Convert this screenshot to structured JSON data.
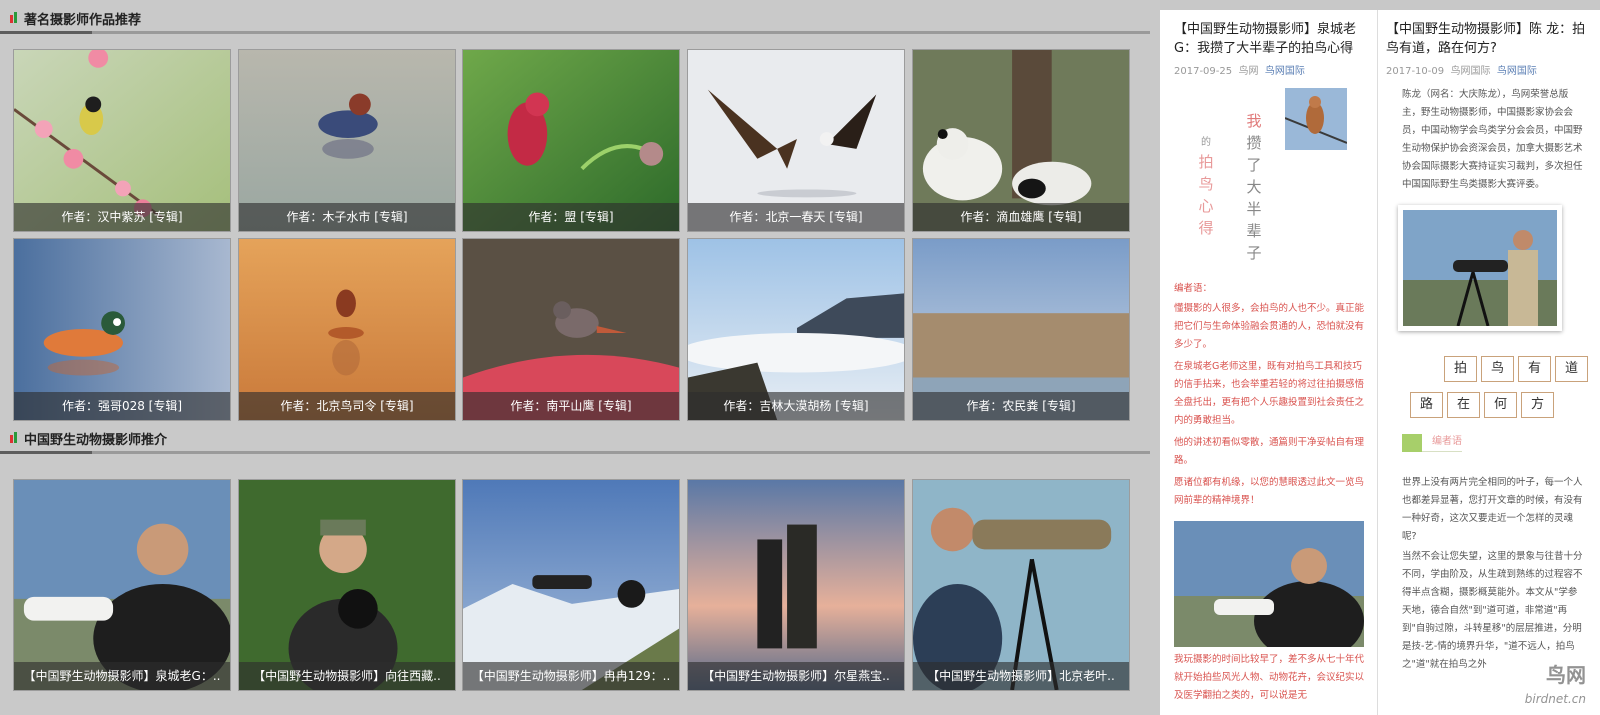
{
  "section1": {
    "title": "著名摄影师作品推荐"
  },
  "section2": {
    "title": "中国野生动物摄影师推介"
  },
  "works_row1": [
    {
      "caption": "作者：汉中紫苏 [专辑]"
    },
    {
      "caption": "作者：木子水市 [专辑]"
    },
    {
      "caption": "作者：盟 [专辑]"
    },
    {
      "caption": "作者：北京一春天 [专辑]"
    },
    {
      "caption": "作者：滴血雄鹰 [专辑]"
    }
  ],
  "works_row2": [
    {
      "caption": "作者：强哥028 [专辑]"
    },
    {
      "caption": "作者：北京鸟司令 [专辑]"
    },
    {
      "caption": "作者：南平山鹰 [专辑]"
    },
    {
      "caption": "作者：吉林大漠胡杨 [专辑]"
    },
    {
      "caption": "作者：农民粪 [专辑]"
    }
  ],
  "photographers": [
    {
      "caption": "【中国野生动物摄影师】泉城老G：.."
    },
    {
      "caption": "【中国野生动物摄影师】向往西藏.."
    },
    {
      "caption": "【中国野生动物摄影师】冉冉129：.."
    },
    {
      "caption": "【中国野生动物摄影师】尔星燕宝.."
    },
    {
      "caption": "【中国野生动物摄影师】北京老叶.."
    }
  ],
  "article1": {
    "title": "【中国野生动物摄影师】泉城老G：我攒了大半辈子的拍鸟心得",
    "date": "2017-09-25",
    "source": "鸟网",
    "link": "鸟网国际",
    "vertical_right": [
      "我",
      "攒",
      "了",
      "大",
      "半",
      "辈",
      "子"
    ],
    "vertical_left_small": "的",
    "vertical_left": [
      "拍",
      "鸟",
      "心",
      "得"
    ],
    "editor_label": "编者语：",
    "paragraphs": [
      "懂摄影的人很多，会拍鸟的人也不少。真正能把它们与生命体验融会贯通的人，恐怕就没有多少了。",
      "在泉城老G老师这里，既有对拍鸟工具和技巧的信手拈来，也会举重若轻的将过往拍摄感悟全盘托出，更有把个人乐趣投置到社会责任之内的勇敢担当。",
      "他的讲述初看似零散，通篇则干净妥帖自有理路。",
      "愿诸位都有机缘，以您的慧眼透过此文一览鸟网前辈的精神境界！"
    ],
    "bottom_text": "我玩摄影的时间比较早了，差不多从七十年代就开始拍些风光人物、动物花卉，会议纪实以及医学翻拍之类的，可以说是无"
  },
  "article2": {
    "title": "【中国野生动物摄影师】陈 龙：拍鸟有道，路在何方?",
    "date": "2017-10-09",
    "source": "鸟网国际",
    "link": "鸟网国际",
    "bio": "陈龙（网名：大庆陈龙），鸟网荣誉总版主，野生动物摄影师，中国摄影家协会会员，中国动物学会鸟类学分会会员，中国野生动物保护协会资深会员，加拿大摄影艺术协会国际摄影大赛持证实习裁判，多次担任中国国际野生鸟类摄影大赛评委。",
    "boxes_row1": [
      "拍",
      "鸟",
      "有",
      "道"
    ],
    "boxes_row2": [
      "路",
      "在",
      "何",
      "方"
    ],
    "editor_tag": "编者语",
    "para1": "世界上没有两片完全相同的叶子，每一个人也都差异显著，您打开文章的时候，有没有一种好奇，这次又要走近一个怎样的灵魂呢?",
    "para2": "当然不会让您失望，这里的景象与往昔十分不同，学由阶及，从生疏到熟练的过程容不得半点含糊，摄影概莫能外。本文从\"学参天地，德合自然\"到\"道可道，非常道\"再到\"自驹过隙，斗转星移\"的层层推进，分明是技-艺-情的境界升华，\"道不远人，拍鸟之\"道\"就在拍鸟之外"
  },
  "watermark": {
    "cn": "鸟网",
    "en": "birdnet.cn"
  }
}
